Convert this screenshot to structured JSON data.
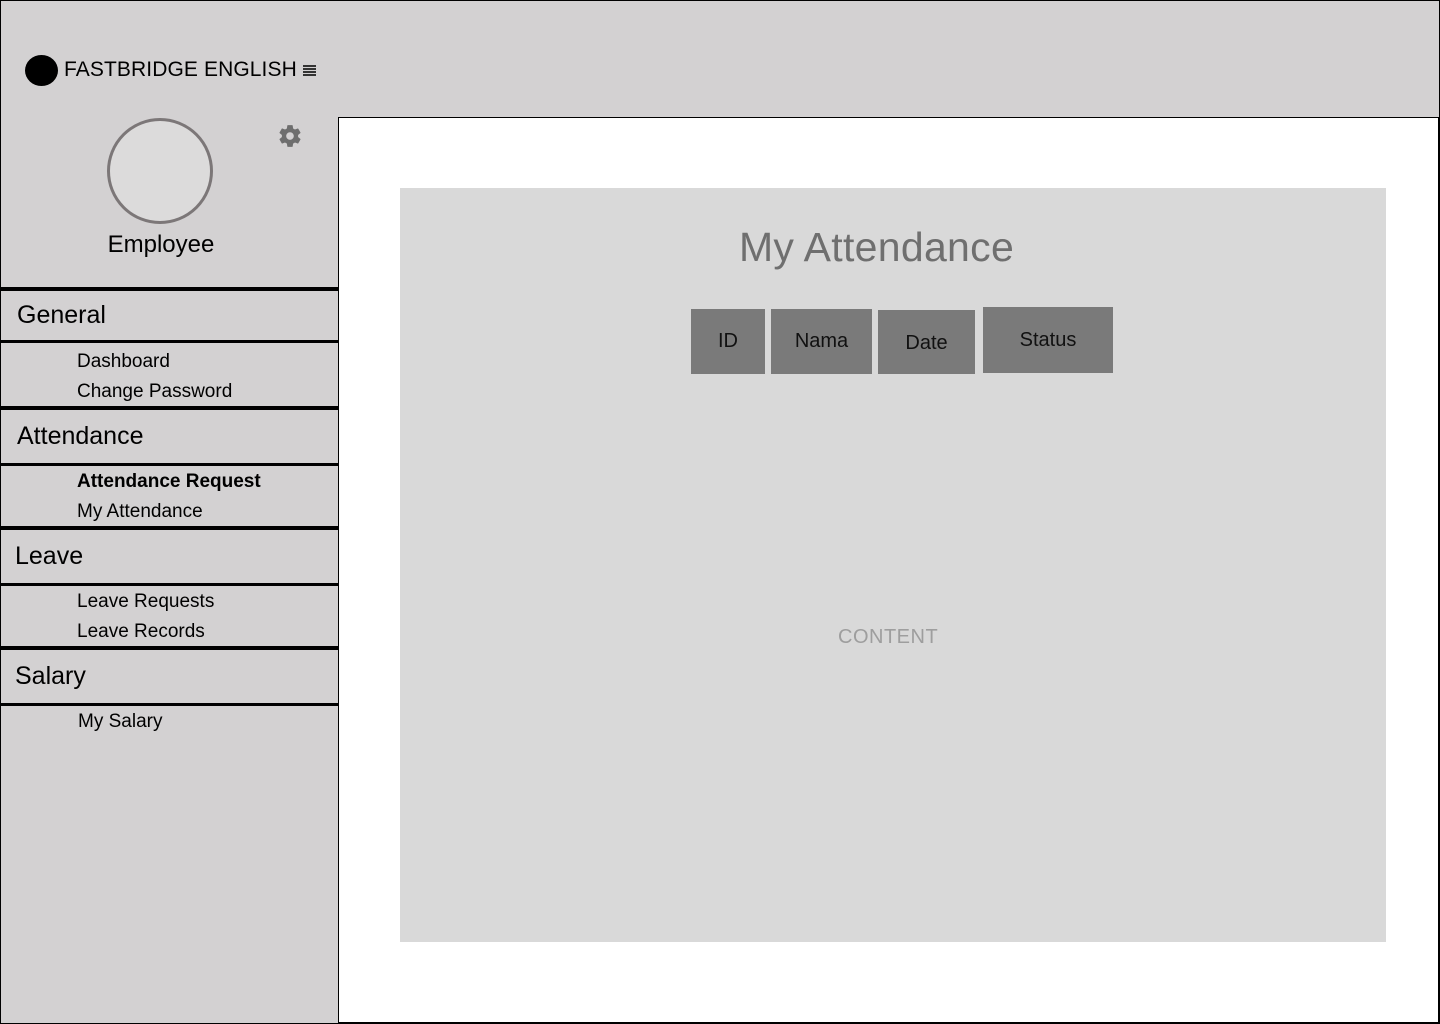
{
  "brand": {
    "name": "FASTBRIDGE ENGLISH"
  },
  "profile": {
    "role": "Employee"
  },
  "sidebar": {
    "sections": [
      {
        "title": "General",
        "items": [
          "Dashboard",
          "Change Password"
        ]
      },
      {
        "title": "Attendance",
        "items": [
          "Attendance Request",
          "My Attendance"
        ]
      },
      {
        "title": "Leave",
        "items": [
          "Leave Requests",
          "Leave Records"
        ]
      },
      {
        "title": "Salary",
        "items": [
          "My Salary"
        ]
      }
    ],
    "active_item": "Attendance Request"
  },
  "main": {
    "title": "My Attendance",
    "columns": [
      "ID",
      "Nama",
      "Date",
      "Status"
    ],
    "placeholder": "CONTENT"
  },
  "colors": {
    "sidebar_bg": "#d3d1d2",
    "card_bg": "#d9d9d9",
    "header_cell": "#7a7a7a"
  }
}
